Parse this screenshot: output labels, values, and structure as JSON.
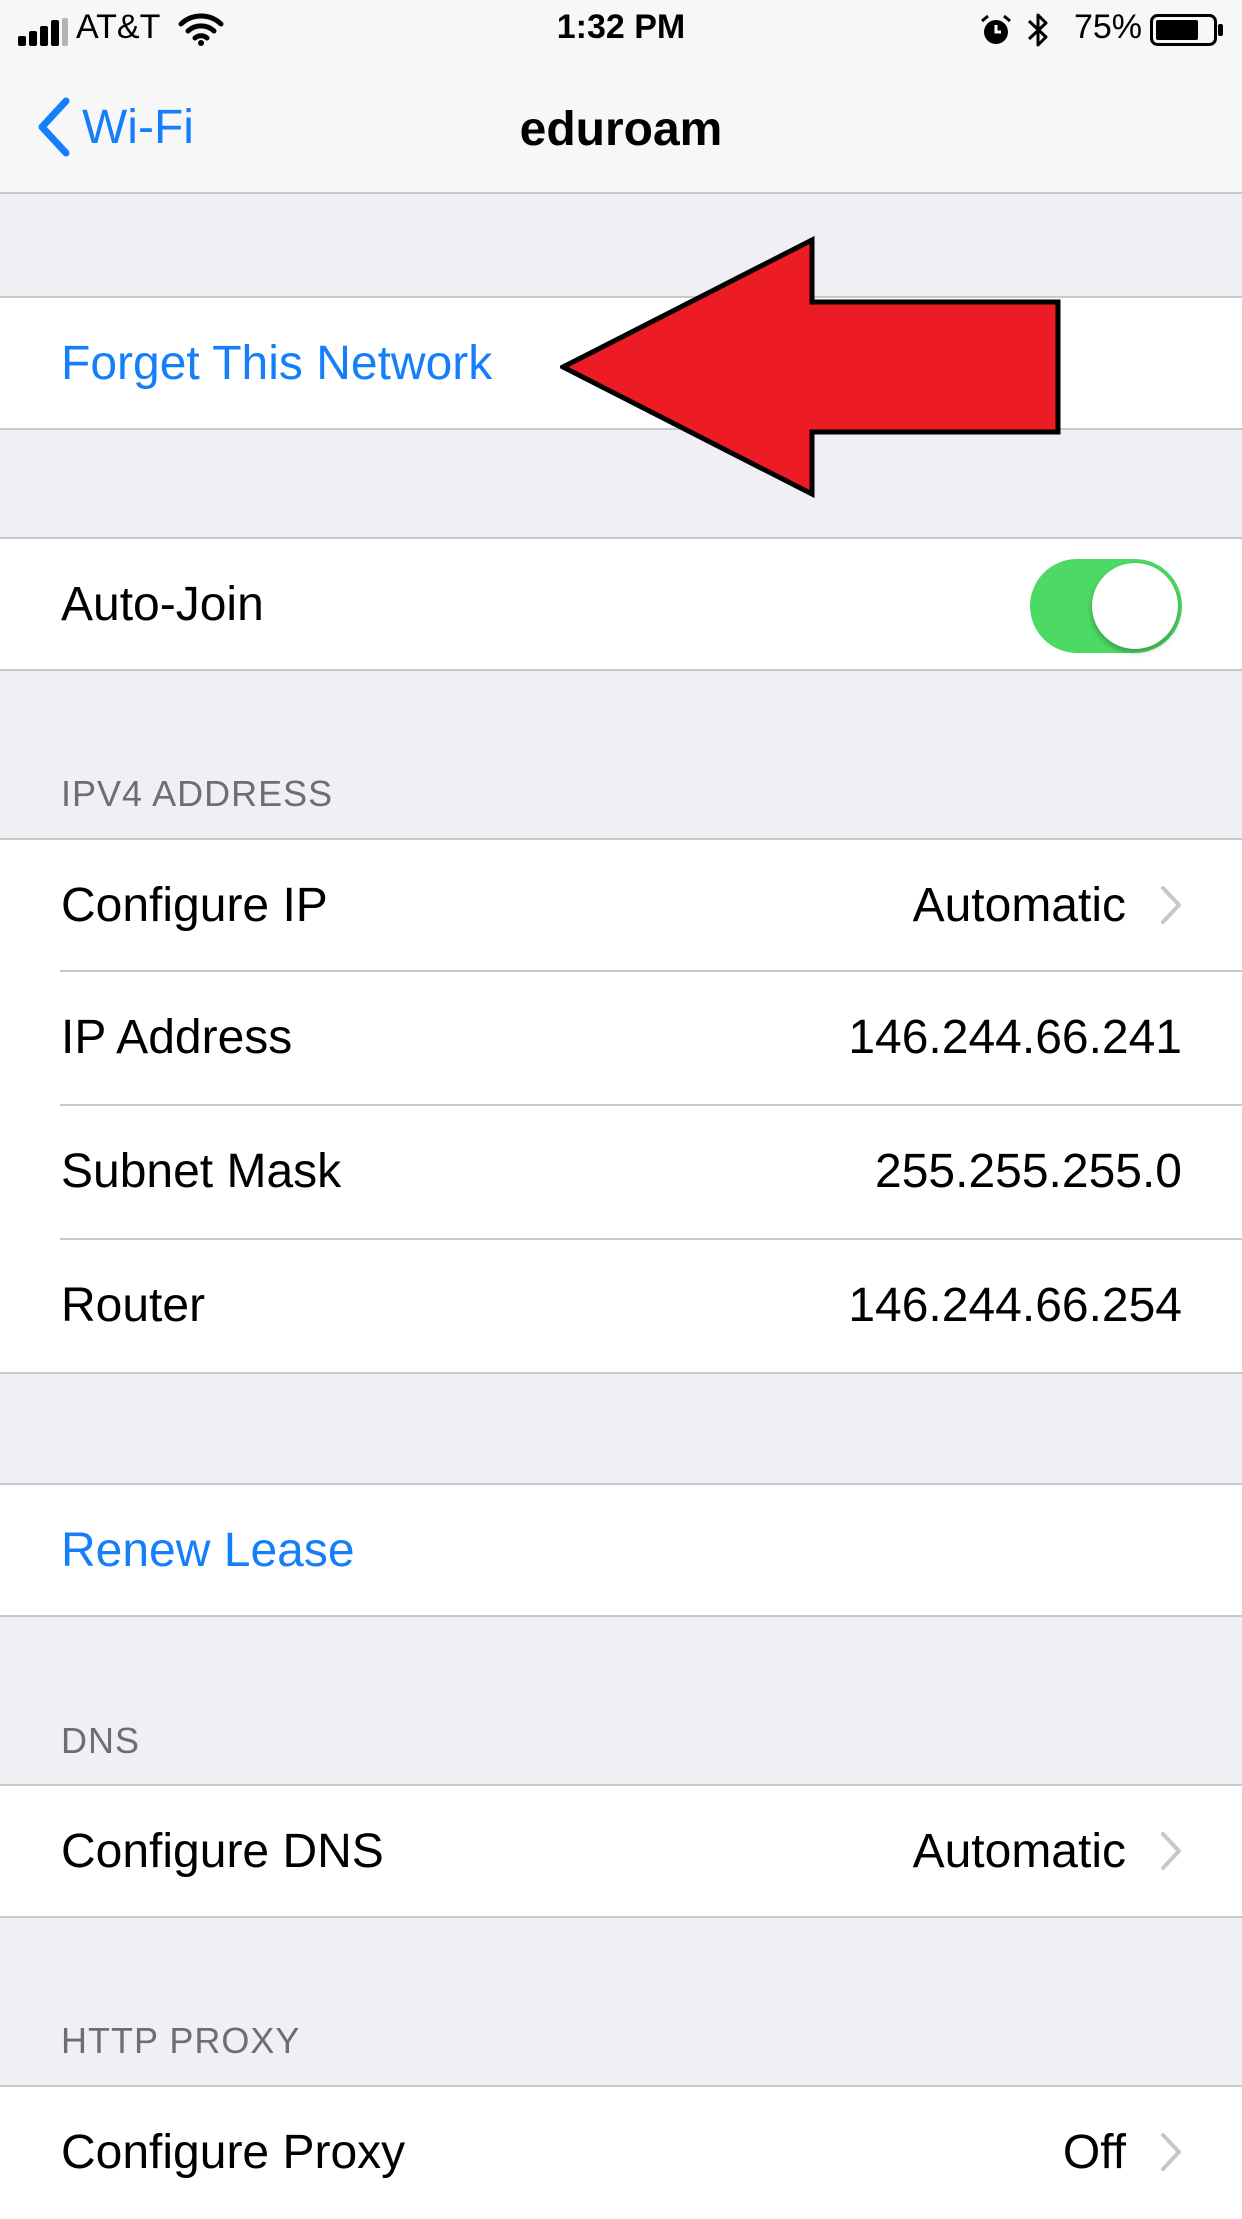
{
  "status_bar": {
    "carrier": "AT&T",
    "time": "1:32 PM",
    "battery_percent": "75%",
    "battery_level": 0.75,
    "icons": [
      "signal-bars-icon",
      "wifi-icon",
      "alarm-icon",
      "bluetooth-icon",
      "battery-icon"
    ]
  },
  "nav": {
    "back_label": "Wi-Fi",
    "title": "eduroam"
  },
  "forget_network": {
    "label": "Forget This Network"
  },
  "auto_join": {
    "label": "Auto-Join",
    "enabled": true
  },
  "ipv4": {
    "header": "IPV4 ADDRESS",
    "configure_ip": {
      "label": "Configure IP",
      "value": "Automatic"
    },
    "ip_address": {
      "label": "IP Address",
      "value": "146.244.66.241"
    },
    "subnet_mask": {
      "label": "Subnet Mask",
      "value": "255.255.255.0"
    },
    "router": {
      "label": "Router",
      "value": "146.244.66.254"
    }
  },
  "renew_lease": {
    "label": "Renew Lease"
  },
  "dns": {
    "header": "DNS",
    "configure_dns": {
      "label": "Configure DNS",
      "value": "Automatic"
    }
  },
  "http_proxy": {
    "header": "HTTP PROXY",
    "configure_proxy": {
      "label": "Configure Proxy",
      "value": "Off"
    }
  },
  "colors": {
    "accent": "#147efb",
    "toggle_on": "#4cd964",
    "annotation_arrow": "#ed1c24",
    "background": "#efeff4"
  }
}
